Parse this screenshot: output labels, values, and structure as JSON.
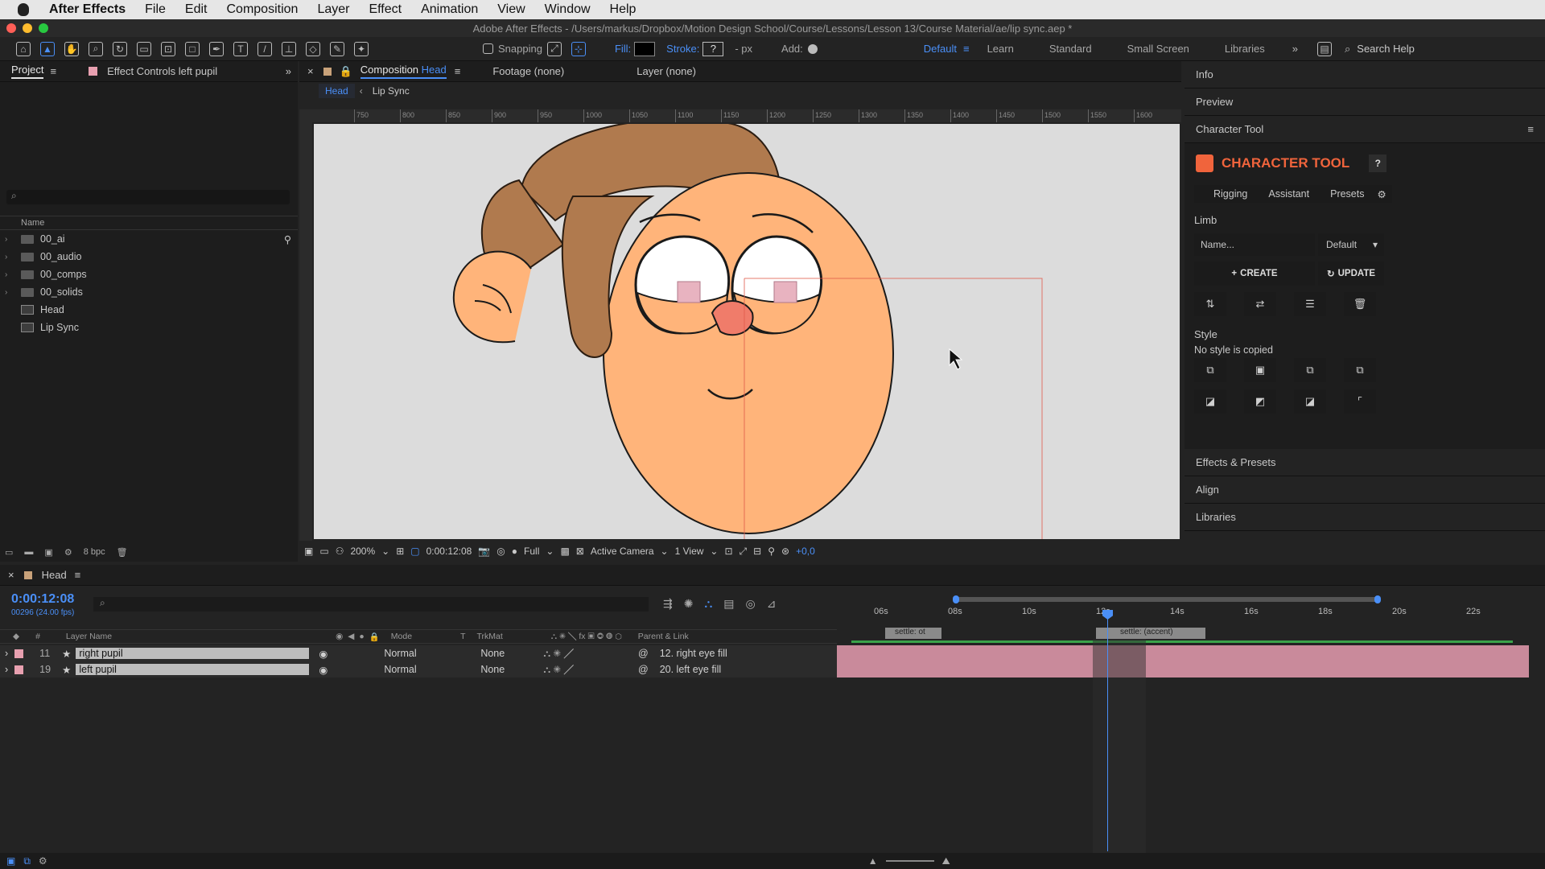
{
  "menubar": {
    "app_name": "After Effects",
    "items": [
      "File",
      "Edit",
      "Composition",
      "Layer",
      "Effect",
      "Animation",
      "View",
      "Window",
      "Help"
    ]
  },
  "titlebar": {
    "title": "Adobe After Effects - /Users/markus/Dropbox/Motion Design School/Course/Lessons/Lesson 13/Course Material/ae/lip sync.aep *"
  },
  "toolbar": {
    "snapping_label": "Snapping",
    "fill_label": "Fill:",
    "stroke_label": "Stroke:",
    "stroke_value": "?",
    "px_label": "- px",
    "add_label": "Add:",
    "workspaces": [
      "Default",
      "Learn",
      "Standard",
      "Small Screen",
      "Libraries"
    ],
    "active_workspace": "Default",
    "search_placeholder": "Search Help"
  },
  "project_panel": {
    "tab_project": "Project",
    "tab_effect_controls": "Effect Controls left pupil",
    "column_name": "Name",
    "items": [
      {
        "label": "00_ai",
        "kind": "folder"
      },
      {
        "label": "00_audio",
        "kind": "folder"
      },
      {
        "label": "00_comps",
        "kind": "folder"
      },
      {
        "label": "00_solids",
        "kind": "folder"
      },
      {
        "label": "Head",
        "kind": "comp"
      },
      {
        "label": "Lip Sync",
        "kind": "comp"
      }
    ],
    "bpc": "8 bpc"
  },
  "viewer": {
    "tab_composition_prefix": "Composition",
    "tab_composition_name": "Head",
    "tab_footage": "Footage (none)",
    "tab_layer": "Layer (none)",
    "breadcrumb": [
      "Head",
      "Lip Sync"
    ],
    "ruler_ticks": [
      "750",
      "800",
      "850",
      "900",
      "950",
      "1000",
      "1050",
      "1100",
      "1150",
      "1200",
      "1250",
      "1300",
      "1350",
      "1400",
      "1450",
      "1500",
      "1550",
      "1600"
    ],
    "zoom": "200%",
    "timecode": "0:00:12:08",
    "resolution": "Full",
    "camera": "Active Camera",
    "views": "1 View",
    "exposure": "+0,0"
  },
  "right_panel": {
    "sections_top": [
      "Info",
      "Preview",
      "Character Tool"
    ],
    "ct_title": "CHARACTER TOOL",
    "ct_help": "?",
    "ct_tabs": [
      "Rigging",
      "Assistant",
      "Presets"
    ],
    "limb_label": "Limb",
    "limb_name_placeholder": "Name...",
    "limb_default": "Default",
    "create_label": "CREATE",
    "update_label": "UPDATE",
    "style_label": "Style",
    "style_status": "No style is copied",
    "sections_bottom": [
      "Effects & Presets",
      "Align",
      "Libraries"
    ]
  },
  "timeline": {
    "comp_name": "Head",
    "timecode": "0:00:12:08",
    "frame_info": "00296 (24.00 fps)",
    "columns": {
      "layer_name": "Layer Name",
      "mode": "Mode",
      "t": "T",
      "trkmat": "TrkMat",
      "parent": "Parent & Link"
    },
    "ruler": [
      "06s",
      "08s",
      "10s",
      "12s",
      "14s",
      "16s",
      "18s",
      "20s",
      "22s"
    ],
    "markers": [
      "settle: ot",
      "settle: (accent)"
    ],
    "layers": [
      {
        "num": "11",
        "name": "right pupil",
        "mode": "Normal",
        "trkmat": "None",
        "parent": "12. right eye fill"
      },
      {
        "num": "19",
        "name": "left pupil",
        "mode": "Normal",
        "trkmat": "None",
        "parent": "20. left eye fill"
      }
    ]
  }
}
